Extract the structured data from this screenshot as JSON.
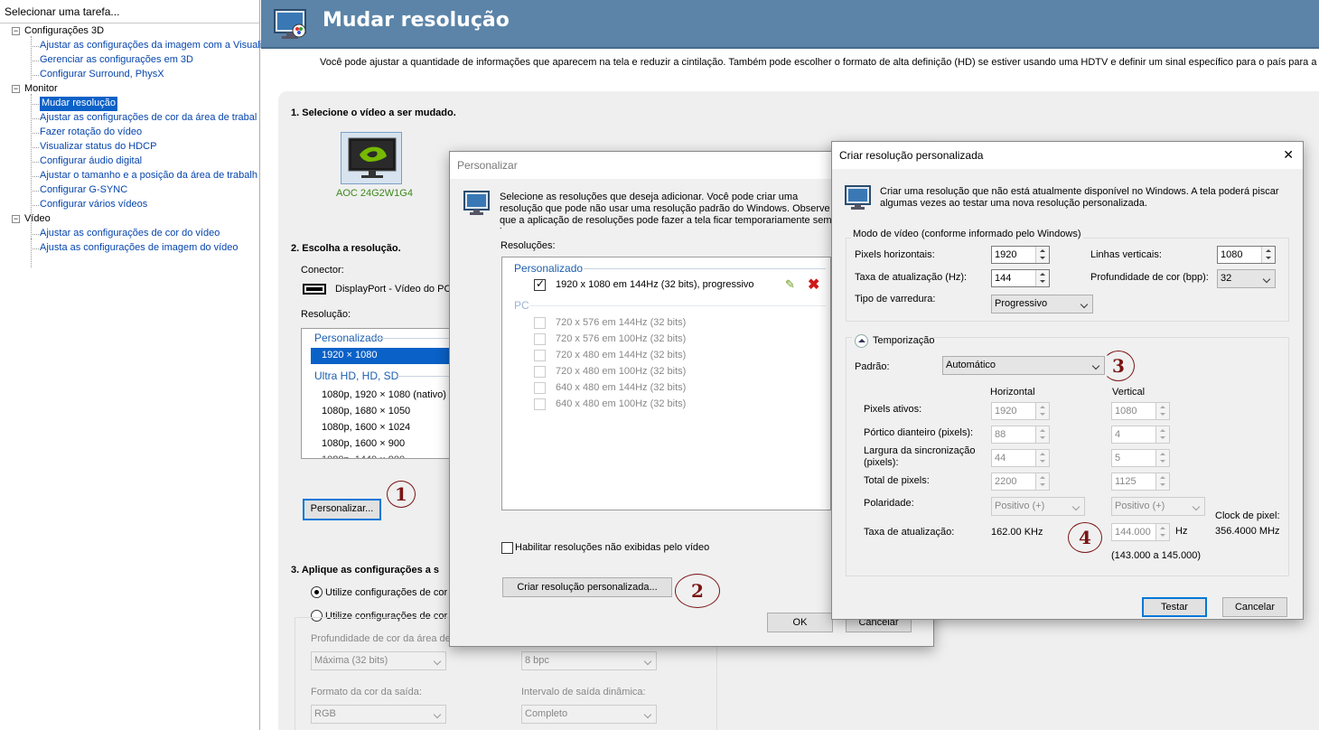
{
  "left_panel": {
    "title": "Selecionar uma tarefa...",
    "tree": [
      {
        "label": "Configurações 3D",
        "type": "cat",
        "expander": "−"
      },
      {
        "label": "Ajustar as configurações da imagem com a Visualiz",
        "type": "leaf"
      },
      {
        "label": "Gerenciar as configurações em 3D",
        "type": "leaf"
      },
      {
        "label": "Configurar Surround, PhysX",
        "type": "leaf"
      },
      {
        "label": "Monitor",
        "type": "cat",
        "expander": "−"
      },
      {
        "label": "Mudar resolução",
        "type": "leaf",
        "selected": true
      },
      {
        "label": "Ajustar as configurações de cor da área de trabal",
        "type": "leaf"
      },
      {
        "label": "Fazer rotação do vídeo",
        "type": "leaf"
      },
      {
        "label": "Visualizar status do HDCP",
        "type": "leaf"
      },
      {
        "label": "Configurar áudio digital",
        "type": "leaf"
      },
      {
        "label": "Ajustar o tamanho e a posição da área de trabalh",
        "type": "leaf"
      },
      {
        "label": "Configurar G-SYNC",
        "type": "leaf"
      },
      {
        "label": "Configurar vários vídeos",
        "type": "leaf"
      },
      {
        "label": "Vídeo",
        "type": "cat",
        "expander": "−"
      },
      {
        "label": "Ajustar as configurações de cor do vídeo",
        "type": "leaf"
      },
      {
        "label": "Ajusta as configurações de imagem do vídeo",
        "type": "leaf"
      }
    ]
  },
  "header": {
    "title": "Mudar resolução",
    "description": "Você pode ajustar a quantidade de informações que aparecem na tela e reduzir  a cintilação. Também pode escolher o formato de alta definição (HD) se estiver usando uma HDTV e definir um sinal específico para o país para a sua TV."
  },
  "main": {
    "step1": "1. Selecione o vídeo a ser mudado.",
    "display_name": "AOC 24G2W1G4",
    "step2": "2. Escolha a resolução.",
    "connector_label": "Conector:",
    "connector_value": "DisplayPort - Vídeo do PC",
    "resolution_label": "Resolução:",
    "res_groups": [
      {
        "header": "Personalizado",
        "items": [
          "1920 × 1080"
        ]
      },
      {
        "header": "Ultra HD, HD, SD",
        "items": [
          "1080p, 1920 × 1080 (nativo)",
          "1080p, 1680 × 1050",
          "1080p, 1600 × 1024",
          "1080p, 1600 × 900"
        ]
      }
    ],
    "customize_button": "Personalizar...",
    "step3": "3. Aplique as configurações a s",
    "radio1": "Utilize configurações de cor p",
    "radio2": "Utilize configurações de cor d",
    "depth_label": "Profundidade de cor da área de",
    "depth_value": "Máxima (32 bits)",
    "bpc_value": "8 bpc",
    "color_format_label": "Formato da cor da saída:",
    "color_format_value": "RGB",
    "dyn_range_label": "Intervalo de saída dinâmica:",
    "dyn_range_value": "Completo"
  },
  "customize_dialog": {
    "title": "Personalizar",
    "description": "Selecione as resoluções que deseja adicionar. Você pode criar uma resolução que pode não usar uma resolução padrão do Windows. Observe que a aplicação de resoluções pode fazer a tela ficar temporariamente sem imagem.",
    "resolutions_label": "Resoluções:",
    "custom_header": "Personalizado",
    "custom_items": [
      "1920 x 1080 em 144Hz (32 bits), progressivo"
    ],
    "pc_header": "PC",
    "pc_items": [
      "720 x 576 em 144Hz (32 bits)",
      "720 x 576 em 100Hz (32 bits)",
      "720 x 480 em 144Hz (32 bits)",
      "720 x 480 em 100Hz (32 bits)",
      "640 x 480 em 144Hz (32 bits)",
      "640 x 480 em 100Hz (32 bits)"
    ],
    "enable_hidden": "Habilitar resoluções não exibidas pelo vídeo",
    "create_button": "Criar resolução personalizada...",
    "ok_button": "OK",
    "cancel_button": "Cancelar"
  },
  "create_dialog": {
    "title": "Criar resolução personalizada",
    "close_symbol": "✕",
    "description": "Criar uma resolução que não está atualmente disponível no Windows. A tela poderá piscar algumas vezes ao testar uma nova resolução personalizada.",
    "mode_group": "Modo de vídeo (conforme informado pelo Windows)",
    "h_pixels_label": "Pixels horizontais:",
    "h_pixels_value": "1920",
    "v_lines_label": "Linhas verticais:",
    "v_lines_value": "1080",
    "refresh_label": "Taxa de atualização (Hz):",
    "refresh_value": "144",
    "depth_label": "Profundidade de cor (bpp):",
    "depth_value": "32",
    "scan_label": "Tipo de varredura:",
    "scan_value": "Progressivo",
    "timing_label": "Temporização",
    "standard_label": "Padrão:",
    "standard_value": "Automático",
    "col_h": "Horizontal",
    "col_v": "Vertical",
    "active_label": "Pixels ativos:",
    "active_h": "1920",
    "active_v": "1080",
    "porch_label": "Pórtico dianteiro (pixels):",
    "porch_h": "88",
    "porch_v": "4",
    "sync_label": "Largura da sincronização (pixels):",
    "sync_h": "44",
    "sync_v": "5",
    "total_label": "Total de pixels:",
    "total_h": "2200",
    "total_v": "1125",
    "polarity_label": "Polaridade:",
    "polarity_h": "Positivo (+)",
    "polarity_v": "Positivo (+)",
    "rate_label": "Taxa de atualização:",
    "rate_h": "162.00 KHz",
    "rate_v": "144.000",
    "rate_unit": "Hz",
    "rate_range": "(143.000 a 145.000)",
    "clock_label": "Clock de pixel:",
    "clock_value": "356.4000 MHz",
    "test_button": "Testar",
    "cancel_button": "Cancelar"
  },
  "annotations": [
    "1",
    "2",
    "3",
    "4"
  ]
}
